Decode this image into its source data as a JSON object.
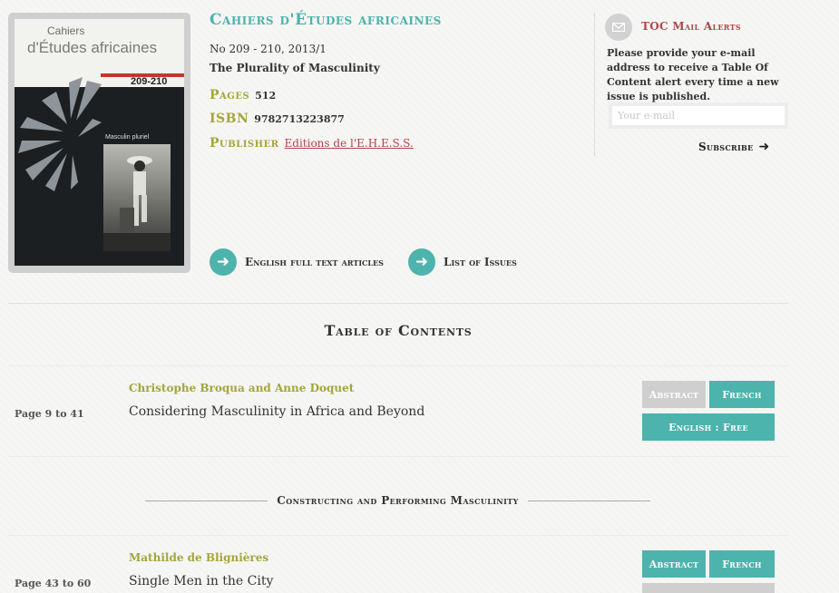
{
  "cover": {
    "title_line1": "Cahiers",
    "title_line2": "d'Études africaines",
    "issue_number": "209-210",
    "subtitle": "Masculin pluriel"
  },
  "journal": {
    "title": "Cahiers d'Études africaines",
    "number": "No 209 - 210, 2013/1",
    "issue_title": "The Plurality of Masculinity",
    "pages_label": "Pages",
    "pages_value": "512",
    "isbn_label": "ISBN",
    "isbn_value": "9782713223877",
    "publisher_label": "Publisher",
    "publisher_value": "Editions de l'E.H.E.S.S."
  },
  "actions": {
    "english_full_text": "English full text articles",
    "list_of_issues": "List of Issues"
  },
  "alerts": {
    "title": "TOC Mail Alerts",
    "description": "Please provide your e-mail address to receive a Table Of Content alert every time a new issue is published.",
    "email_placeholder": "Your e-mail",
    "subscribe_label": "Subscribe"
  },
  "toc": {
    "heading": "Table of Contents",
    "articles": [
      {
        "page": "Page 9 to 41",
        "authors": "Christophe Broqua and Anne Doquet",
        "title": "Considering Masculinity in Africa and Beyond",
        "abstract": "Abstract",
        "french": "French",
        "english": "English : Free"
      },
      {
        "page": "Page 43 to 60",
        "authors": "Mathilde de Blignières",
        "title": "Single Men in the City",
        "abstract": "Abstract",
        "french": "French"
      }
    ],
    "section": "Constructing and Performing Masculinity"
  },
  "colors": {
    "accent_teal": "#4db3ad",
    "olive": "#a3a63a",
    "red_link": "#b0454a",
    "disabled_grey": "#cfcfcf"
  }
}
